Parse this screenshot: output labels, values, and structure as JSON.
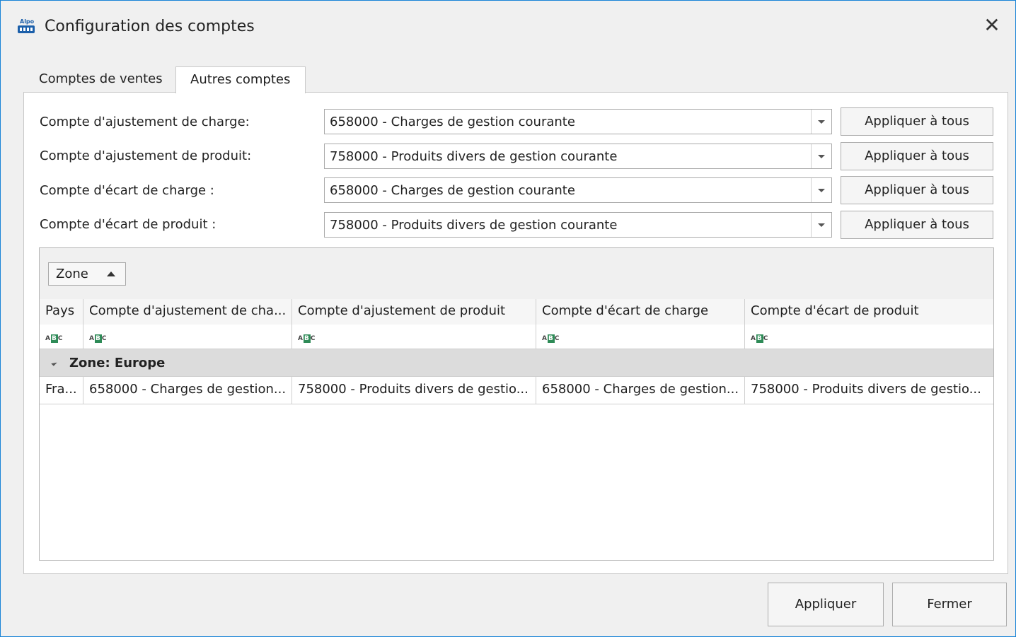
{
  "window": {
    "title": "Configuration des comptes",
    "close_glyph": "✕",
    "icon_text": "Alpo"
  },
  "tabs": [
    {
      "label": "Comptes de ventes",
      "active": false
    },
    {
      "label": "Autres comptes",
      "active": true
    }
  ],
  "fields": [
    {
      "label": "Compte d'ajustement de charge:",
      "value": "658000 - Charges de gestion courante",
      "button": "Appliquer à tous"
    },
    {
      "label": "Compte d'ajustement de produit:",
      "value": "758000 - Produits divers de gestion courante",
      "button": "Appliquer à tous"
    },
    {
      "label": "Compte d'écart de charge :",
      "value": "658000 - Charges de gestion courante",
      "button": "Appliquer à tous"
    },
    {
      "label": "Compte d'écart de produit :",
      "value": "758000 - Produits divers de gestion courante",
      "button": "Appliquer à tous"
    }
  ],
  "grid": {
    "group_chip": "Zone",
    "columns": [
      "Pays",
      "Compte d'ajustement de cha...",
      "Compte d'ajustement de produit",
      "Compte d'écart de charge",
      "Compte d'écart de produit"
    ],
    "filter_icon": "abc-filter-icon",
    "group_row": "Zone: Europe",
    "rows": [
      [
        "Fra...",
        "658000 - Charges de gestion...",
        "758000 - Produits divers de gestio...",
        "658000 - Charges de gestion...",
        "758000 - Produits divers de gestio..."
      ]
    ]
  },
  "footer": {
    "apply": "Appliquer",
    "close": "Fermer"
  }
}
